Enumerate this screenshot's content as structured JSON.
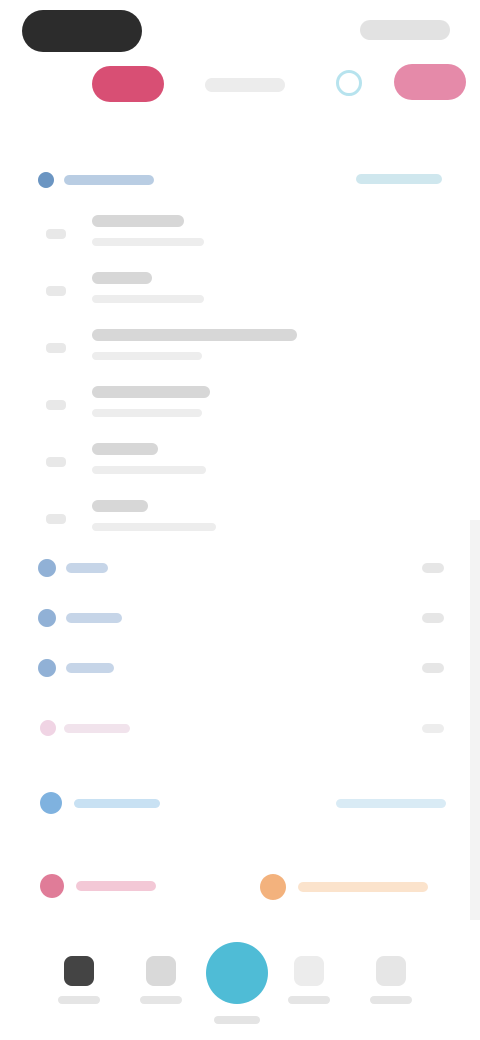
{
  "status_bar": {
    "time": "",
    "indicators": ""
  },
  "top_bar": {
    "left_badge": "",
    "title": "",
    "center_icon": "refresh-icon",
    "right_badge": "",
    "accent_left": "#d84f74",
    "accent_right": "#e58aa9"
  },
  "section": {
    "title": "",
    "link": ""
  },
  "list": [
    {
      "title": "",
      "subtitle": "",
      "title_w": 92,
      "sub_w": 112
    },
    {
      "title": "",
      "subtitle": "",
      "title_w": 60,
      "sub_w": 112
    },
    {
      "title": "",
      "subtitle": "",
      "title_w": 205,
      "sub_w": 110
    },
    {
      "title": "",
      "subtitle": "",
      "title_w": 118,
      "sub_w": 110
    },
    {
      "title": "",
      "subtitle": "",
      "title_w": 66,
      "sub_w": 114
    },
    {
      "title": "",
      "subtitle": "",
      "title_w": 56,
      "sub_w": 124
    }
  ],
  "values": [
    {
      "label": "",
      "value": "",
      "label_w": 42
    },
    {
      "label": "",
      "value": "",
      "label_w": 56
    },
    {
      "label": "",
      "value": "",
      "label_w": 48
    }
  ],
  "extra_row": {
    "label": "",
    "value": ""
  },
  "info": {
    "label": "",
    "link": ""
  },
  "actions": {
    "left": "",
    "right": ""
  },
  "bottom_nav": {
    "items": [
      {
        "label": "",
        "icon": "grid-icon"
      },
      {
        "label": "",
        "icon": "document-icon"
      },
      {
        "label": "",
        "icon": "add-icon"
      },
      {
        "label": "",
        "icon": "chart-icon"
      },
      {
        "label": "",
        "icon": "user-icon"
      }
    ],
    "accent": "#4fbcd6"
  }
}
